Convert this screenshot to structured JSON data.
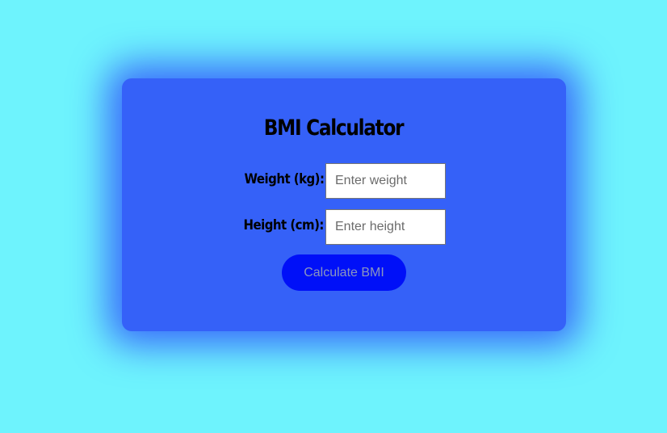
{
  "calculator": {
    "title": "BMI Calculator",
    "weight": {
      "label": "Weight (kg):",
      "value": "",
      "placeholder": "Enter weight"
    },
    "height": {
      "label": "Height (cm):",
      "value": "",
      "placeholder": "Enter height"
    },
    "button_label": "Calculate BMI"
  },
  "colors": {
    "page_background": "#6ef3fd",
    "card_background": "#3561f8",
    "button_background": "#0010f8",
    "button_text": "#8a96bf",
    "label_text": "#000000"
  }
}
